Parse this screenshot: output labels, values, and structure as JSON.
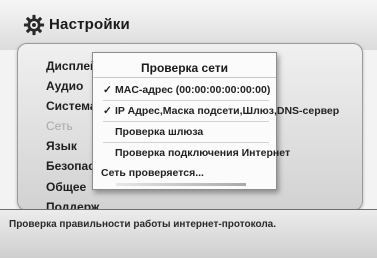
{
  "header": {
    "title": "Настройки",
    "icon": "gear-icon"
  },
  "menu": {
    "items": [
      {
        "label": "Дисплей",
        "dim": false
      },
      {
        "label": "Аудио",
        "dim": false
      },
      {
        "label": "Система",
        "dim": false
      },
      {
        "label": "Сеть",
        "dim": true
      },
      {
        "label": "Язык",
        "dim": false
      },
      {
        "label": "Безопасн",
        "dim": false
      },
      {
        "label": "Общее",
        "dim": false
      },
      {
        "label": "Поддерж",
        "dim": false
      }
    ]
  },
  "dialog": {
    "title": "Проверка сети",
    "checks": [
      {
        "label": "MAC-адрес (00:00:00:00:00:00)",
        "checked": true
      },
      {
        "label": "IP Адрес,Маска подсети,Шлюз,DNS-сервер",
        "checked": true
      },
      {
        "label": "Проверка шлюза",
        "checked": false
      },
      {
        "label": "Проверка подключения Интернет",
        "checked": false
      }
    ],
    "status": "Сеть проверяется...",
    "check_mark": "✓"
  },
  "footer": {
    "hint": "Проверка правильности работы интернет-протокола."
  }
}
